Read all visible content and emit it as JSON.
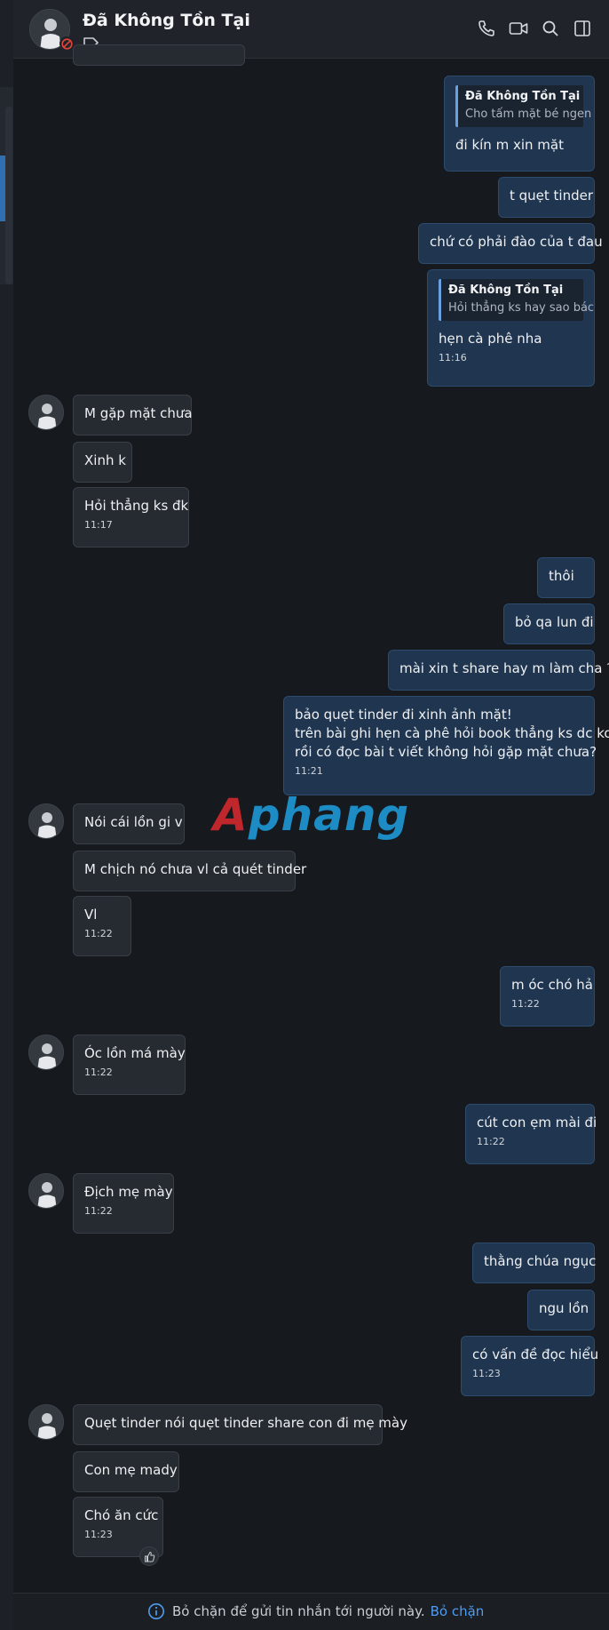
{
  "header": {
    "title": "Đã Không Tồn Tại",
    "icons": [
      "phone-icon",
      "video-icon",
      "search-icon",
      "sidebar-toggle-icon"
    ]
  },
  "messages": {
    "m1": {
      "quote_name": "Đã Không Tồn Tại",
      "quote_text": "Cho tấm mặt bé ngen",
      "text": "đi kín m xin mặt"
    },
    "m2": {
      "text": "t quẹt tinder"
    },
    "m3": {
      "text": "chứ có phải đào của t đau"
    },
    "m4": {
      "quote_name": "Đã Không Tồn Tại",
      "quote_text": "Hỏi thẳng ks hay sao bác",
      "text": "hẹn cà phê nha",
      "time": "11:16"
    },
    "m5": {
      "text": "M gặp mặt chưa"
    },
    "m6": {
      "text": "Xinh k"
    },
    "m7": {
      "text": "Hỏi thẳng ks đk",
      "time": "11:17"
    },
    "m8": {
      "text": "thôi"
    },
    "m9": {
      "text": "bỏ qa lun đi"
    },
    "m10": {
      "text": "mài xin t share hay m làm cha ?"
    },
    "m11": {
      "line1": "bảo quẹt tinder đi xinh ảnh mặt!",
      "line2": "trên bài ghi hẹn cà phê hỏi book thẳng ks dc ko?",
      "line3": "rồi có đọc bài t viết không hỏi gặp mặt chưa?",
      "time": "11:21"
    },
    "m12": {
      "text": "Nói cái lồn gi v"
    },
    "m13": {
      "text": "M chịch nó chưa vl cả quét tinder"
    },
    "m14": {
      "text": "Vl",
      "time": "11:22"
    },
    "m15": {
      "text": "m óc chó hả",
      "time": "11:22"
    },
    "m16": {
      "text": "Óc lồn má mày",
      "time": "11:22"
    },
    "m17": {
      "text": "cút con ẹm mài đi",
      "time": "11:22"
    },
    "m18": {
      "text": "Địch mẹ mày",
      "time": "11:22"
    },
    "m19": {
      "text": "thằng chúa ngục"
    },
    "m20": {
      "text": "ngu lồn"
    },
    "m21": {
      "text": "có vấn đề đọc hiểu",
      "time": "11:23"
    },
    "m22": {
      "text": "Quẹt tinder nói quẹt tinder share con đi mẹ mày"
    },
    "m23": {
      "text": "Con mẹ mady"
    },
    "m24": {
      "text": "Chó ăn cức",
      "time": "11:23"
    }
  },
  "watermark": {
    "part1": "A",
    "part2": "phang"
  },
  "footer": {
    "text": "Bỏ chặn để gửi tin nhắn tới người này.",
    "link": "Bỏ chặn"
  },
  "colors": {
    "background": "#16191e",
    "incoming_bubble": "#262a31",
    "outgoing_bubble": "#1f3550",
    "accent": "#4f9cf0",
    "quote_bar": "#6aa0de"
  }
}
